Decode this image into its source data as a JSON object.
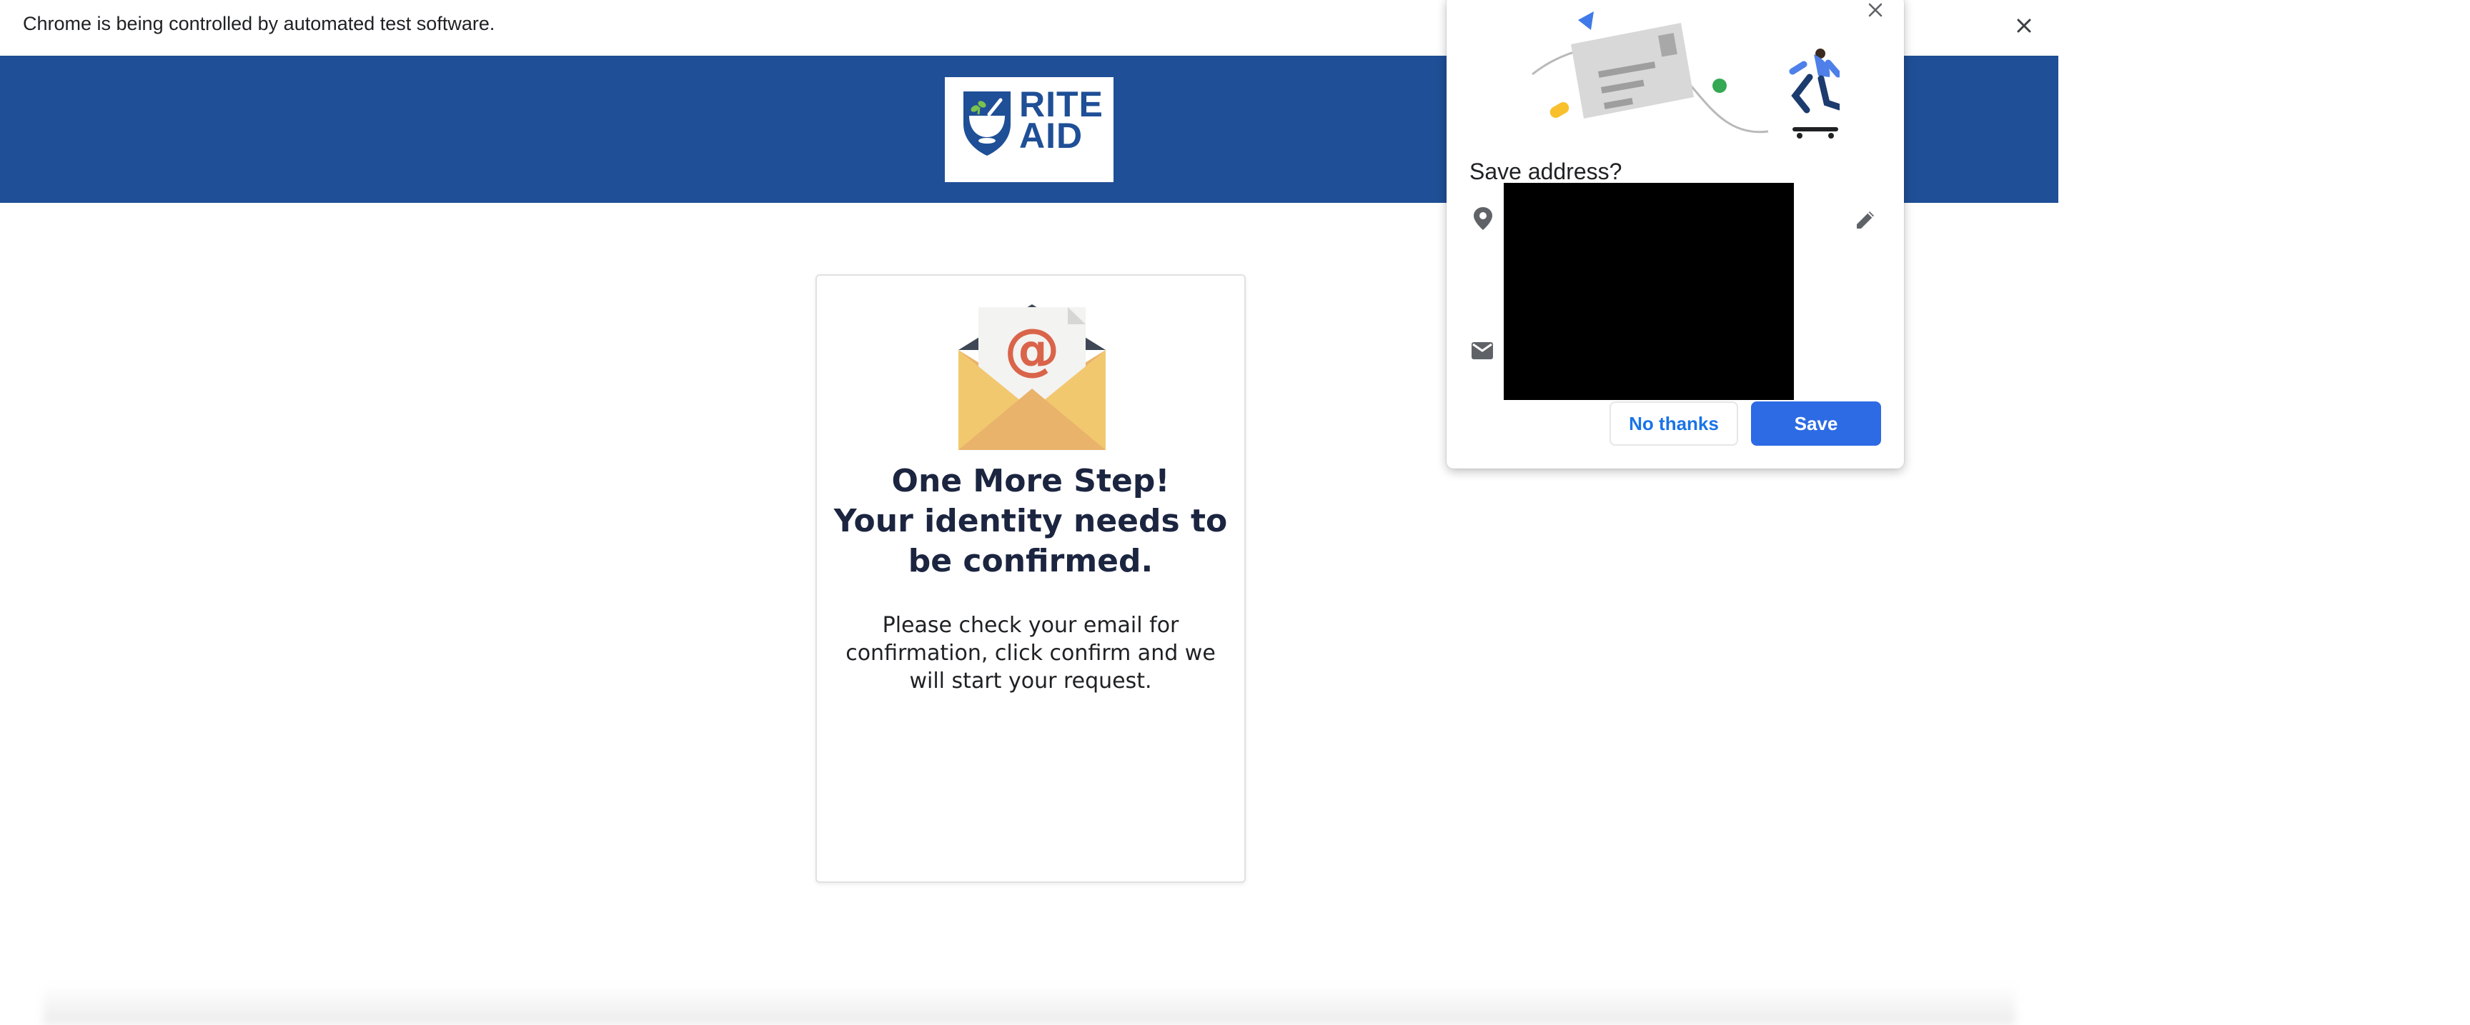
{
  "infobar": {
    "message": "Chrome is being controlled by automated test software."
  },
  "header": {
    "logo_line1": "RITE",
    "logo_line2": "AID",
    "background": "#1f4f96"
  },
  "card": {
    "title_line1": "One More Step!",
    "title_line2": "Your identity needs to be confirmed.",
    "body": "Please check your email for confirmation, click confirm and we will start your request.",
    "icon": "envelope-at-icon"
  },
  "popup": {
    "title": "Save address?",
    "no_thanks_label": "No thanks",
    "save_label": "Save",
    "accent": "#2d6be4"
  }
}
